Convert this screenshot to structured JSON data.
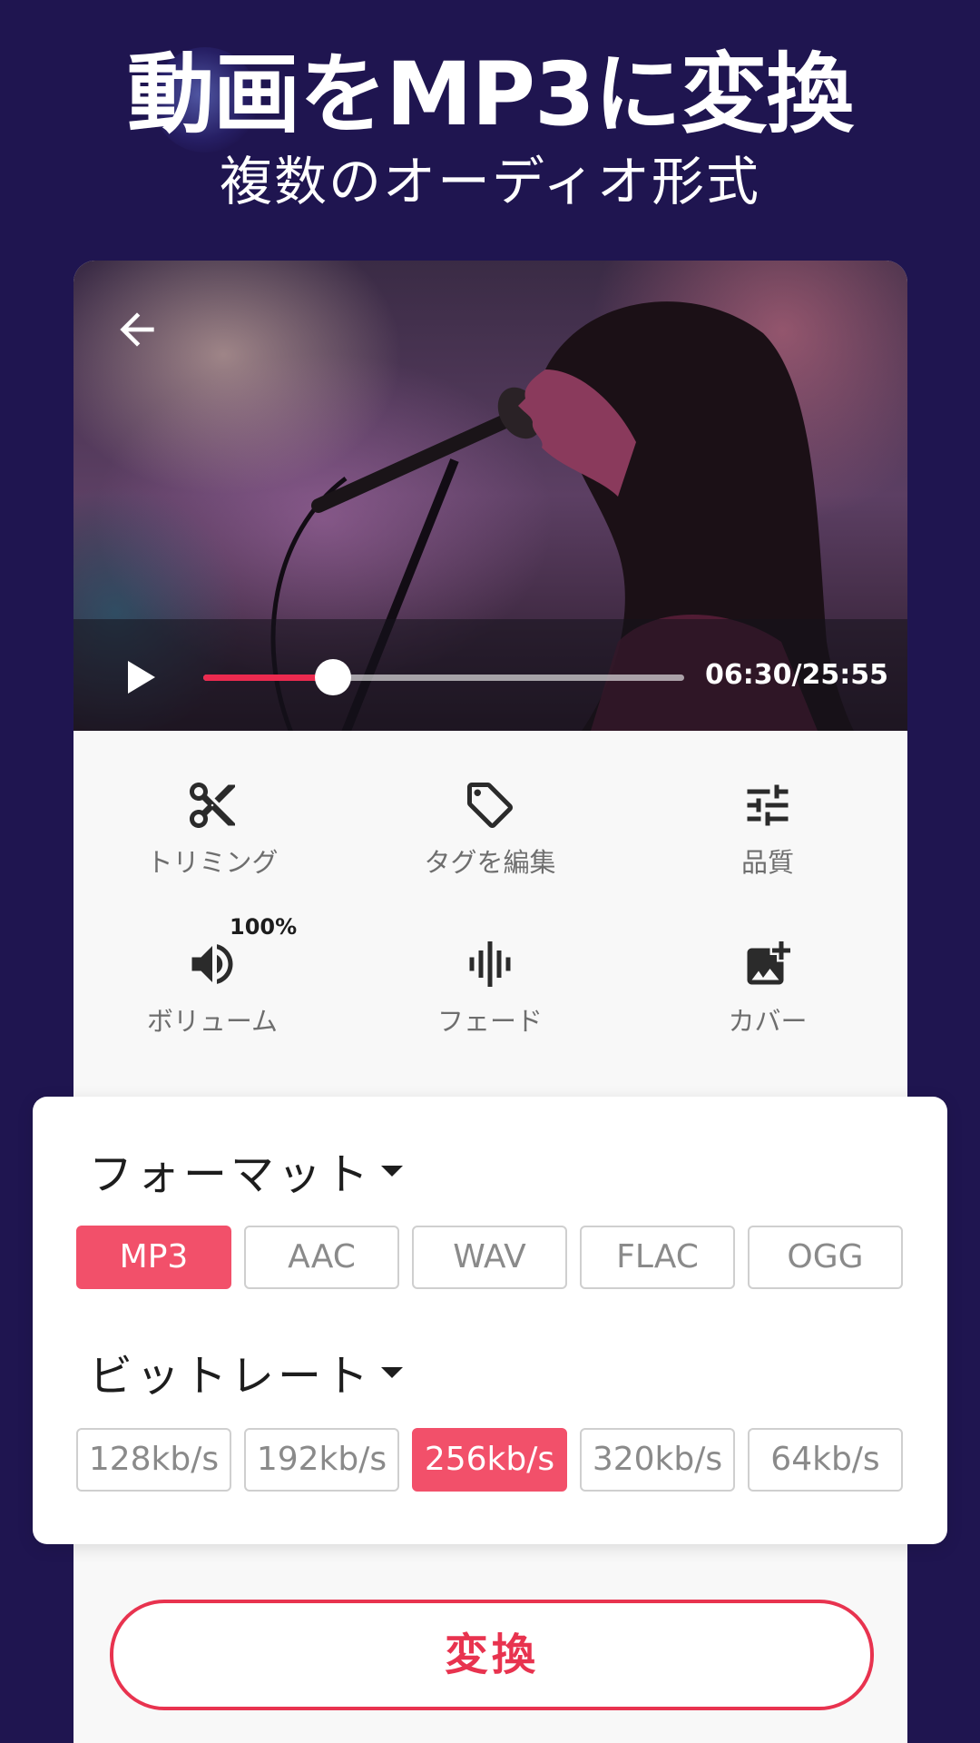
{
  "headline": "動画をMP3に変換",
  "subheadline": "複数のオーディオ形式",
  "player": {
    "time": "06:30/25:55",
    "progress_fraction": 0.27
  },
  "tools": [
    {
      "label": "トリミング",
      "icon": "scissors-icon"
    },
    {
      "label": "タグを編集",
      "icon": "tag-icon"
    },
    {
      "label": "品質",
      "icon": "sliders-icon"
    },
    {
      "label": "ボリューム",
      "icon": "volume-icon",
      "badge": "100%"
    },
    {
      "label": "フェード",
      "icon": "waveform-icon"
    },
    {
      "label": "カバー",
      "icon": "add-image-icon"
    }
  ],
  "format": {
    "title": "フォーマット",
    "options": [
      "MP3",
      "AAC",
      "WAV",
      "FLAC",
      "OGG"
    ],
    "selected": "MP3"
  },
  "bitrate": {
    "title": "ビットレート",
    "options": [
      "128kb/s",
      "192kb/s",
      "256kb/s",
      "320kb/s",
      "64kb/s"
    ],
    "selected": "256kb/s"
  },
  "convert_label": "変換",
  "colors": {
    "background": "#1f1550",
    "accent": "#f2506a",
    "progress": "#ec2a4f"
  }
}
